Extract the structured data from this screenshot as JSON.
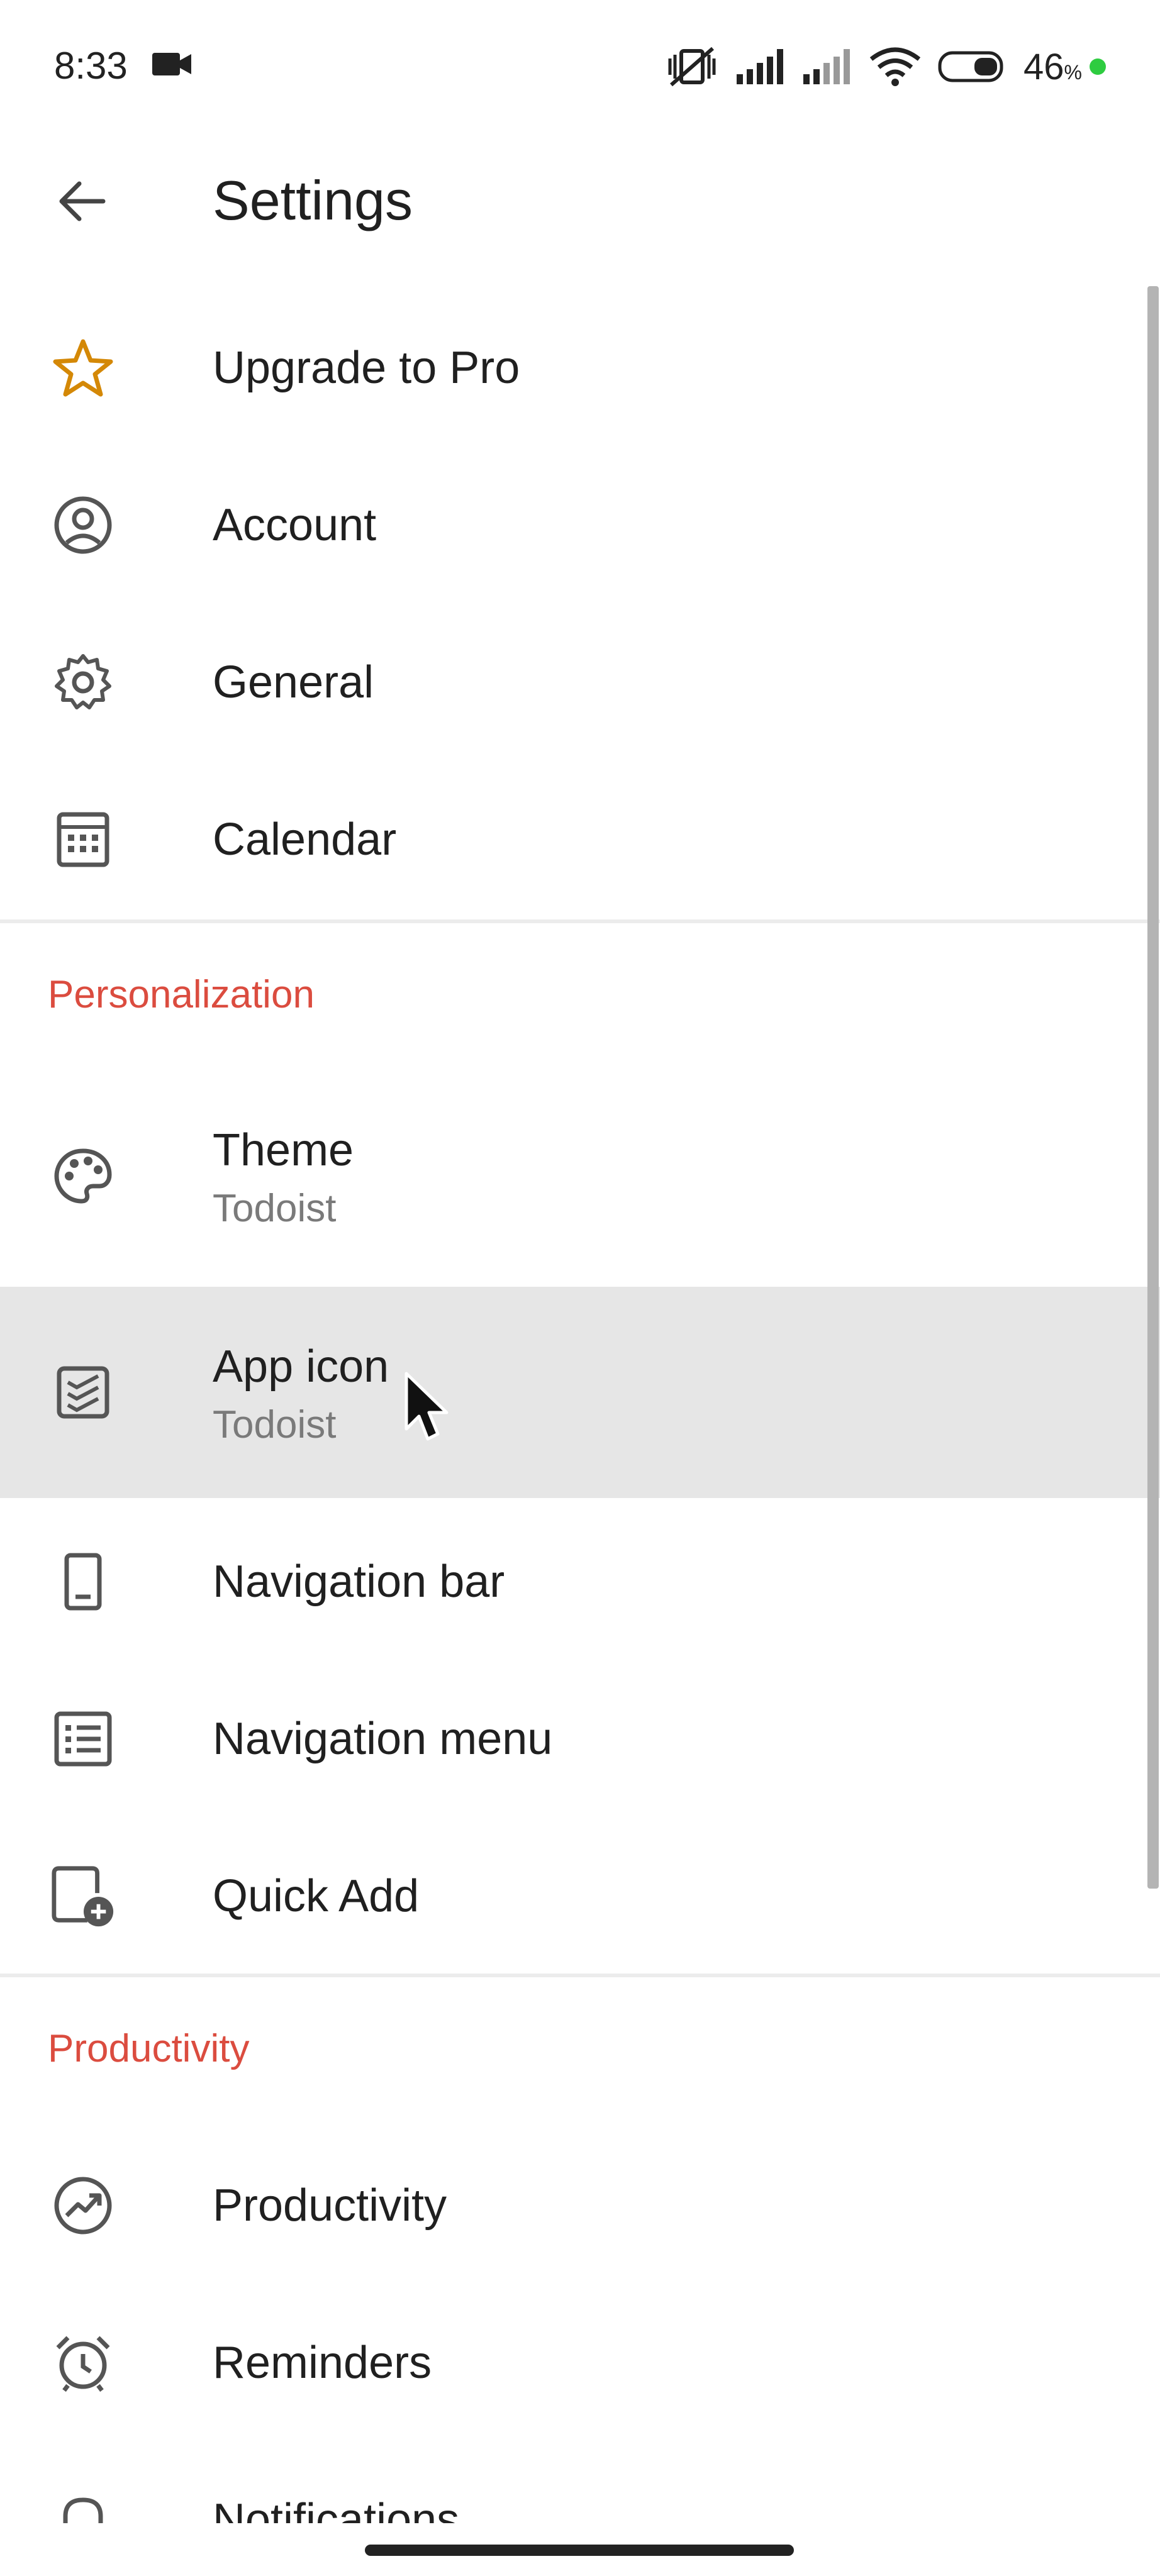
{
  "status_bar": {
    "time": "8:33",
    "battery_percent": "46",
    "battery_unit": "%",
    "icons": [
      "video-camera-icon",
      "vibrate-off-icon",
      "signal-icon",
      "signal-icon",
      "wifi-icon",
      "battery-icon"
    ]
  },
  "app_bar": {
    "title": "Settings",
    "back_icon": "arrow-left-icon"
  },
  "items_top": [
    {
      "label": "Upgrade to Pro",
      "icon": "star-icon"
    },
    {
      "label": "Account",
      "icon": "account-circle-icon"
    },
    {
      "label": "General",
      "icon": "gear-icon"
    },
    {
      "label": "Calendar",
      "icon": "calendar-icon"
    }
  ],
  "personalization": {
    "header": "Personalization",
    "items": [
      {
        "label": "Theme",
        "sub": "Todoist",
        "icon": "palette-icon"
      },
      {
        "label": "App icon",
        "sub": "Todoist",
        "icon": "app-icon-icon"
      },
      {
        "label": "Navigation bar",
        "icon": "phone-icon"
      },
      {
        "label": "Navigation menu",
        "icon": "list-icon"
      },
      {
        "label": "Quick Add",
        "icon": "quick-add-icon"
      }
    ]
  },
  "productivity": {
    "header": "Productivity",
    "items": [
      {
        "label": "Productivity",
        "icon": "trend-icon"
      },
      {
        "label": "Reminders",
        "icon": "alarm-icon"
      },
      {
        "label": "Notifications",
        "icon": "bell-icon"
      }
    ]
  },
  "colors": {
    "accent": "#db4c3f",
    "star": "#d48806",
    "highlight": "#e6e6e6"
  }
}
